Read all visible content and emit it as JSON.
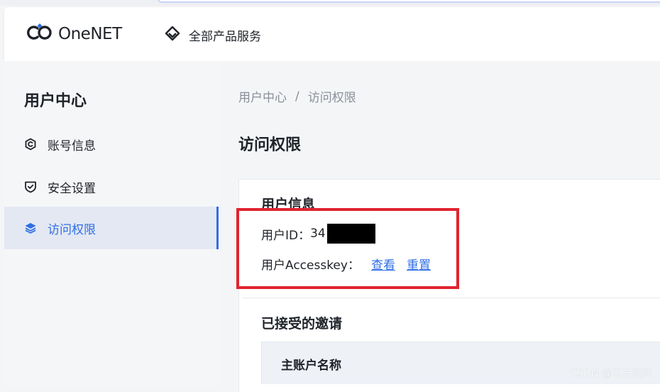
{
  "header": {
    "logo_text": "OneNET",
    "all_products_label": "全部产品服务"
  },
  "sidebar": {
    "title": "用户中心",
    "items": [
      {
        "label": "账号信息",
        "icon": "account-icon",
        "active": false
      },
      {
        "label": "安全设置",
        "icon": "shield-icon",
        "active": false
      },
      {
        "label": "访问权限",
        "icon": "layers-icon",
        "active": true
      }
    ]
  },
  "breadcrumb": {
    "items": [
      "用户中心",
      "访问权限"
    ],
    "separator": "/"
  },
  "page": {
    "title": "访问权限"
  },
  "user_info": {
    "section_title": "用户信息",
    "user_id_label": "用户ID：",
    "user_id_value": "34",
    "accesskey_label": "用户Accesskey：",
    "view_link": "查看",
    "reset_link": "重置"
  },
  "invitations": {
    "section_title": "已接受的邀请",
    "columns": [
      "主账户名称"
    ]
  },
  "watermark": "CSDN @三三川川",
  "colors": {
    "accent": "#2f6fe6",
    "highlight_border": "#e02430"
  }
}
